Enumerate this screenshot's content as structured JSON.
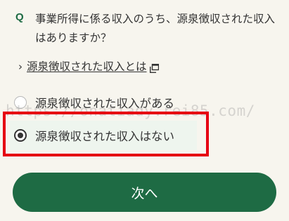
{
  "question": {
    "mark": "Q",
    "text": "事業所得に係る収入のうち、源泉徴収された収入はありますか？"
  },
  "help_link": {
    "chevron": "›",
    "label": "源泉徴収された収入とは",
    "icon": "external-window-icon"
  },
  "options": [
    {
      "label": "源泉徴収された収入がある",
      "selected": false
    },
    {
      "label": "源泉徴収された収入はない",
      "selected": true
    }
  ],
  "watermark": "https://onatiady.rei85.com/",
  "next_button": {
    "label": "次へ"
  },
  "colors": {
    "primary_green": "#1e6b44",
    "highlight_red": "#e60012",
    "background": "#f7f5ee",
    "selected_option_bg": "#eef5ee"
  }
}
